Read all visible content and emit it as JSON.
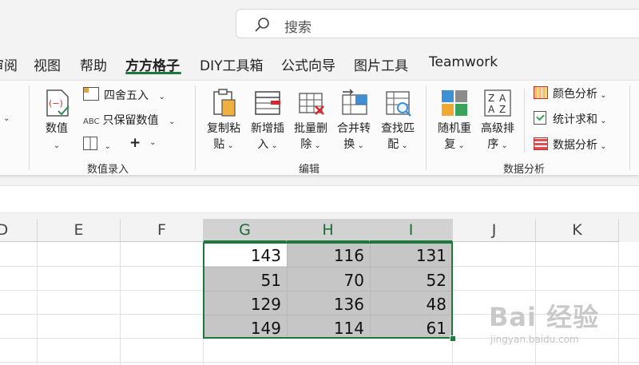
{
  "search": {
    "placeholder": "搜索"
  },
  "tabs": [
    {
      "label": "审阅"
    },
    {
      "label": "视图"
    },
    {
      "label": "帮助"
    },
    {
      "label": "方方格子"
    },
    {
      "label": "DIY工具箱"
    },
    {
      "label": "公式向导"
    },
    {
      "label": "图片工具"
    },
    {
      "label": "Teamwork"
    }
  ],
  "ribbon": {
    "numeric_group": {
      "label": "数值录入",
      "numeric_btn": "数值",
      "round_btn": "四舍五入",
      "keep_numeric_btn": "只保留数值",
      "plus": "+"
    },
    "edit_group": {
      "label": "编辑",
      "copy_paste": [
        "复制粘",
        "贴"
      ],
      "add_insert": [
        "新增插",
        "入"
      ],
      "batch_delete": [
        "批量删",
        "除"
      ],
      "merge_convert": [
        "合并转",
        "换"
      ],
      "find_match": [
        "查找匹",
        "配"
      ]
    },
    "analysis_group": {
      "label": "数据分析",
      "random_repeat": [
        "随机重",
        "复"
      ],
      "advanced_sort": [
        "高级排",
        "序"
      ],
      "color_analysis": "颜色分析",
      "stat_sum": "统计求和",
      "data_analysis": "数据分析"
    }
  },
  "columns": [
    "D",
    "E",
    "F",
    "G",
    "H",
    "I",
    "J",
    "K"
  ],
  "cells": [
    [
      "143",
      "116",
      "131"
    ],
    [
      "51",
      "70",
      "52"
    ],
    [
      "129",
      "136",
      "48"
    ],
    [
      "149",
      "114",
      "61"
    ]
  ],
  "watermark": {
    "brand": "Bai 经验",
    "url": "jingyan.baidu.com"
  },
  "colors": {
    "accent": "#1a7a3c",
    "selection_fill": "#c6c6c6"
  }
}
